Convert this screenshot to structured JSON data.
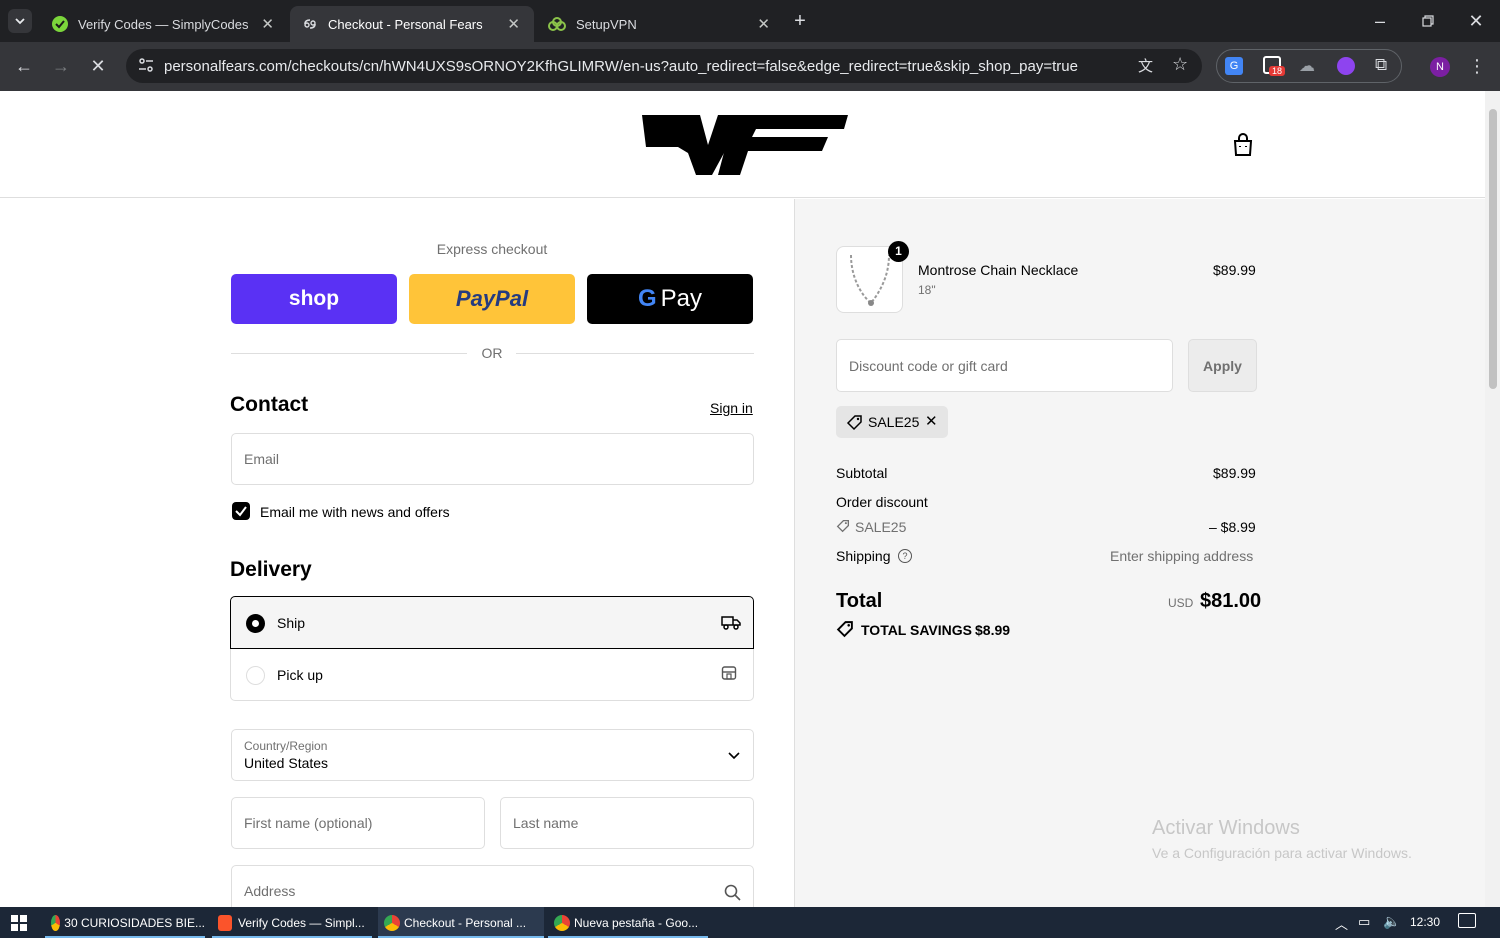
{
  "browser": {
    "tabs": [
      {
        "title": "Verify Codes — SimplyCodes",
        "icon": "simplycodes-icon"
      },
      {
        "title": "Checkout - Personal Fears",
        "icon": "loading-icon"
      },
      {
        "title": "SetupVPN",
        "icon": "setupvpn-icon"
      }
    ],
    "url": "personalfears.com/checkouts/cn/hWN4UXS9sORNOY2KfhGLIMRW/en-us?auto_redirect=false&edge_redirect=true&skip_shop_pay=true",
    "extension_badge": "18",
    "profile_initial": "N"
  },
  "checkout": {
    "express_label": "Express checkout",
    "shop_label": "shop",
    "paypal_label": "PayPal",
    "gpay_label": "Pay",
    "or_label": "OR",
    "contact": {
      "heading": "Contact",
      "sign_in": "Sign in",
      "email_placeholder": "Email",
      "newsletter_label": "Email me with news and offers",
      "newsletter_checked": true
    },
    "delivery": {
      "heading": "Delivery",
      "ship_label": "Ship",
      "pickup_label": "Pick up",
      "selected": "Ship",
      "country_label": "Country/Region",
      "country_value": "United States",
      "first_name_placeholder": "First name (optional)",
      "last_name_placeholder": "Last name",
      "address_placeholder": "Address"
    }
  },
  "summary": {
    "item": {
      "name": "Montrose Chain Necklace",
      "variant": "18\"",
      "price": "$89.99",
      "quantity": "1"
    },
    "discount_placeholder": "Discount code or gift card",
    "apply_label": "Apply",
    "applied_code": "SALE25",
    "subtotal_label": "Subtotal",
    "subtotal_value": "$89.99",
    "order_discount_label": "Order discount",
    "order_discount_code": "SALE25",
    "order_discount_value": "– $8.99",
    "shipping_label": "Shipping",
    "shipping_value": "Enter shipping address",
    "total_label": "Total",
    "total_currency": "USD",
    "total_value": "$81.00",
    "savings_label": "TOTAL SAVINGS",
    "savings_value": "$8.99"
  },
  "watermark": {
    "line1": "Activar Windows",
    "line2": "Ve a Configuración para activar Windows."
  },
  "taskbar": {
    "items": [
      {
        "label": "30 CURIOSIDADES BIE..."
      },
      {
        "label": "Verify Codes — Simpl..."
      },
      {
        "label": "Checkout - Personal ..."
      },
      {
        "label": "Nueva pestaña - Goo..."
      }
    ],
    "time": "12:30"
  },
  "colors": {
    "shop_purple": "#5a31f4",
    "paypal_yellow": "#ffc439",
    "gpay_black": "#000000",
    "taskbar": "#1c2737"
  }
}
